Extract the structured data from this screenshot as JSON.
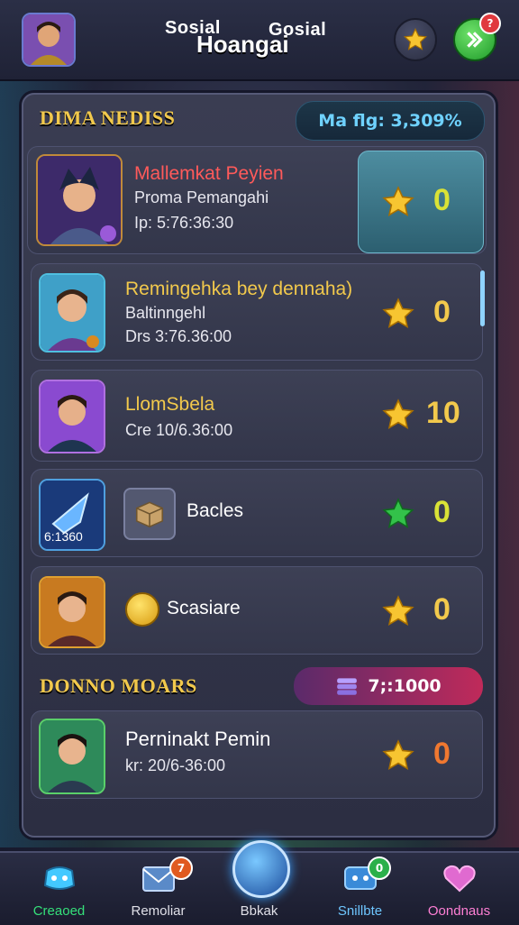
{
  "header": {
    "title_left": "Sosial",
    "title_right": "Gosial",
    "title_main": "Hoangai",
    "star_icon": "star-icon",
    "go_icon": "arrow-right-icon",
    "go_badge": "?"
  },
  "section1": {
    "title": "DIMA NEDISS",
    "pill": "Ma flg: 3,309%"
  },
  "players": [
    {
      "name": "Mallemkat Peyien",
      "sub1": "Proma Pemangahi",
      "sub2": "Ip: 5:76:36:30",
      "score": "0",
      "name_color": "#ff5a5a"
    },
    {
      "name": "Remingehka bey dennaha)",
      "sub1": "Baltinngehl",
      "sub2": "Drs 3:76.36:00",
      "score": "0",
      "name_color": "#f2c94c"
    },
    {
      "name": "LlomSbela",
      "sub1": "Cre 10/6.36:00",
      "score": "10",
      "name_color": "#f2c94c"
    },
    {
      "name": "Bacles",
      "item_caption": "6:1360",
      "score": "0",
      "name_color": "#ffffff"
    },
    {
      "name": "Scasiare",
      "score": "0",
      "name_color": "#ffffff"
    }
  ],
  "section2": {
    "title": "DONNO MOARS",
    "pill": "7;:1000",
    "player": {
      "name": "Perninakt Pemin",
      "sub": "kr: 20/6-36:00",
      "score": "0"
    }
  },
  "nav": [
    {
      "label": "Creaoed",
      "color": "#35e07a",
      "icon": "controller-icon"
    },
    {
      "label": "Remoliar",
      "color": "#e0e0e8",
      "icon": "mail-icon",
      "badge": "7"
    },
    {
      "label": "Bbkak",
      "color": "#e0e0e8",
      "icon": "home-orb-icon"
    },
    {
      "label": "Snillbte",
      "color": "#6ec6ff",
      "icon": "chat-icon",
      "badge": "0"
    },
    {
      "label": "Oondnaus",
      "color": "#ff7fd5",
      "icon": "heart-icon"
    }
  ],
  "colors": {
    "accent_yellow": "#f2c94c",
    "score_yellow": "#d9e236",
    "panel": "#33364a"
  }
}
